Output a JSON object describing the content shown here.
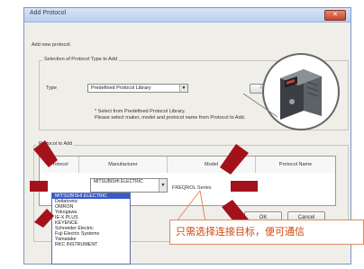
{
  "window": {
    "title": "Add Protocol",
    "close_label": "✕"
  },
  "dialog": {
    "intro": "Add new protocol.",
    "selection_group": "Selection of Protocol Type to Add",
    "type_label": "Type",
    "type_value": "Predefined Protocol Library",
    "note_line1": "* Select from Predefined Protocol Library.",
    "note_line2": "Please select maker, model and protocol name from Protocol to Add.",
    "protocol_group": "Protocol to Add",
    "columns": [
      "Protocol",
      "Manufacturer",
      "Model",
      "Protocol Name"
    ],
    "row": {
      "manufacturer": "MITSUBISHI ELECTRIC",
      "model": "FREQROL Series"
    },
    "manufacturer_options": [
      "MITSUBISHI ELECTRIC",
      "Deltatronic",
      "OMRON",
      "Yokogawa",
      "IE-X PLUS",
      "KEYENCE",
      "Schneider Electric",
      "Fuji Electric Systems",
      "Yamatake",
      "RKC INSTRUMENT"
    ],
    "ok_label": "OK",
    "cancel_label": "Cancel",
    "partial_button": "Pro"
  },
  "callout": {
    "text": "只需选择连接目标，便可通信"
  },
  "colors": {
    "accent_red": "#a3121b",
    "callout_text": "#d0470f",
    "list_selection": "#3a59c9"
  },
  "icons": {
    "device": "inverter-device-icon"
  }
}
